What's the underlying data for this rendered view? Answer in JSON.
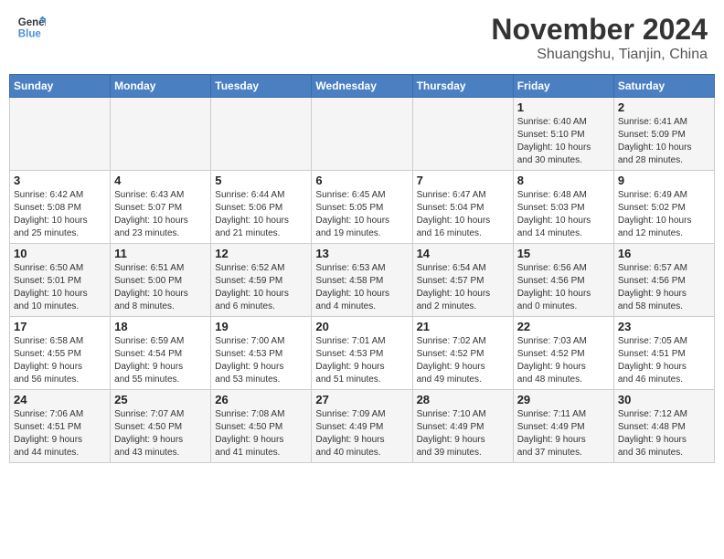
{
  "header": {
    "logo_general": "General",
    "logo_blue": "Blue",
    "month_title": "November 2024",
    "location": "Shuangshu, Tianjin, China"
  },
  "weekdays": [
    "Sunday",
    "Monday",
    "Tuesday",
    "Wednesday",
    "Thursday",
    "Friday",
    "Saturday"
  ],
  "weeks": [
    [
      {
        "day": "",
        "info": ""
      },
      {
        "day": "",
        "info": ""
      },
      {
        "day": "",
        "info": ""
      },
      {
        "day": "",
        "info": ""
      },
      {
        "day": "",
        "info": ""
      },
      {
        "day": "1",
        "info": "Sunrise: 6:40 AM\nSunset: 5:10 PM\nDaylight: 10 hours\nand 30 minutes."
      },
      {
        "day": "2",
        "info": "Sunrise: 6:41 AM\nSunset: 5:09 PM\nDaylight: 10 hours\nand 28 minutes."
      }
    ],
    [
      {
        "day": "3",
        "info": "Sunrise: 6:42 AM\nSunset: 5:08 PM\nDaylight: 10 hours\nand 25 minutes."
      },
      {
        "day": "4",
        "info": "Sunrise: 6:43 AM\nSunset: 5:07 PM\nDaylight: 10 hours\nand 23 minutes."
      },
      {
        "day": "5",
        "info": "Sunrise: 6:44 AM\nSunset: 5:06 PM\nDaylight: 10 hours\nand 21 minutes."
      },
      {
        "day": "6",
        "info": "Sunrise: 6:45 AM\nSunset: 5:05 PM\nDaylight: 10 hours\nand 19 minutes."
      },
      {
        "day": "7",
        "info": "Sunrise: 6:47 AM\nSunset: 5:04 PM\nDaylight: 10 hours\nand 16 minutes."
      },
      {
        "day": "8",
        "info": "Sunrise: 6:48 AM\nSunset: 5:03 PM\nDaylight: 10 hours\nand 14 minutes."
      },
      {
        "day": "9",
        "info": "Sunrise: 6:49 AM\nSunset: 5:02 PM\nDaylight: 10 hours\nand 12 minutes."
      }
    ],
    [
      {
        "day": "10",
        "info": "Sunrise: 6:50 AM\nSunset: 5:01 PM\nDaylight: 10 hours\nand 10 minutes."
      },
      {
        "day": "11",
        "info": "Sunrise: 6:51 AM\nSunset: 5:00 PM\nDaylight: 10 hours\nand 8 minutes."
      },
      {
        "day": "12",
        "info": "Sunrise: 6:52 AM\nSunset: 4:59 PM\nDaylight: 10 hours\nand 6 minutes."
      },
      {
        "day": "13",
        "info": "Sunrise: 6:53 AM\nSunset: 4:58 PM\nDaylight: 10 hours\nand 4 minutes."
      },
      {
        "day": "14",
        "info": "Sunrise: 6:54 AM\nSunset: 4:57 PM\nDaylight: 10 hours\nand 2 minutes."
      },
      {
        "day": "15",
        "info": "Sunrise: 6:56 AM\nSunset: 4:56 PM\nDaylight: 10 hours\nand 0 minutes."
      },
      {
        "day": "16",
        "info": "Sunrise: 6:57 AM\nSunset: 4:56 PM\nDaylight: 9 hours\nand 58 minutes."
      }
    ],
    [
      {
        "day": "17",
        "info": "Sunrise: 6:58 AM\nSunset: 4:55 PM\nDaylight: 9 hours\nand 56 minutes."
      },
      {
        "day": "18",
        "info": "Sunrise: 6:59 AM\nSunset: 4:54 PM\nDaylight: 9 hours\nand 55 minutes."
      },
      {
        "day": "19",
        "info": "Sunrise: 7:00 AM\nSunset: 4:53 PM\nDaylight: 9 hours\nand 53 minutes."
      },
      {
        "day": "20",
        "info": "Sunrise: 7:01 AM\nSunset: 4:53 PM\nDaylight: 9 hours\nand 51 minutes."
      },
      {
        "day": "21",
        "info": "Sunrise: 7:02 AM\nSunset: 4:52 PM\nDaylight: 9 hours\nand 49 minutes."
      },
      {
        "day": "22",
        "info": "Sunrise: 7:03 AM\nSunset: 4:52 PM\nDaylight: 9 hours\nand 48 minutes."
      },
      {
        "day": "23",
        "info": "Sunrise: 7:05 AM\nSunset: 4:51 PM\nDaylight: 9 hours\nand 46 minutes."
      }
    ],
    [
      {
        "day": "24",
        "info": "Sunrise: 7:06 AM\nSunset: 4:51 PM\nDaylight: 9 hours\nand 44 minutes."
      },
      {
        "day": "25",
        "info": "Sunrise: 7:07 AM\nSunset: 4:50 PM\nDaylight: 9 hours\nand 43 minutes."
      },
      {
        "day": "26",
        "info": "Sunrise: 7:08 AM\nSunset: 4:50 PM\nDaylight: 9 hours\nand 41 minutes."
      },
      {
        "day": "27",
        "info": "Sunrise: 7:09 AM\nSunset: 4:49 PM\nDaylight: 9 hours\nand 40 minutes."
      },
      {
        "day": "28",
        "info": "Sunrise: 7:10 AM\nSunset: 4:49 PM\nDaylight: 9 hours\nand 39 minutes."
      },
      {
        "day": "29",
        "info": "Sunrise: 7:11 AM\nSunset: 4:49 PM\nDaylight: 9 hours\nand 37 minutes."
      },
      {
        "day": "30",
        "info": "Sunrise: 7:12 AM\nSunset: 4:48 PM\nDaylight: 9 hours\nand 36 minutes."
      }
    ]
  ]
}
